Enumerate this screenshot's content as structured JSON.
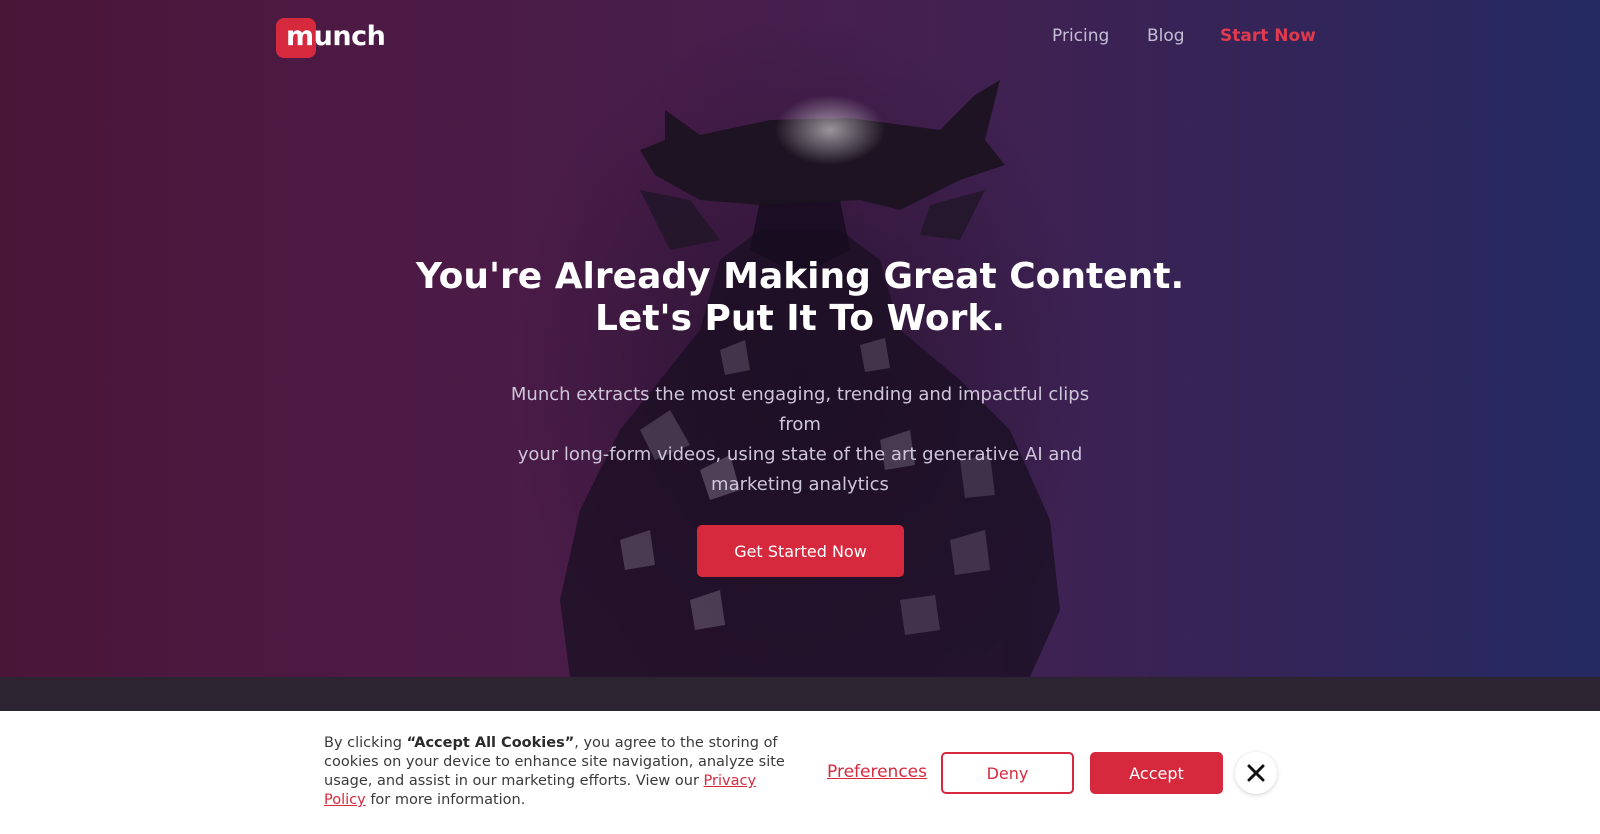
{
  "nav": {
    "logo_text": "munch",
    "links": [
      "Pricing",
      "Blog",
      "Start Now"
    ]
  },
  "hero": {
    "headline_line1": "You're Already Making Great Content.",
    "headline_line2": "Let's Put It To Work.",
    "subtext_line1": "Munch extracts the most engaging, trending and impactful clips from",
    "subtext_line2": "your long-form videos, using state of the art generative AI and",
    "subtext_line3": "marketing analytics",
    "cta_label": "Get Started Now"
  },
  "cookie": {
    "text_before": "By clicking ",
    "text_bold": "“Accept All Cookies”",
    "text_middle": ", you agree to the storing of cookies on your device to enhance site navigation, analyze site usage, and assist in our marketing efforts. View our ",
    "privacy_link": "Privacy Policy",
    "text_after": " for more information.",
    "preferences_label": "Preferences",
    "deny_label": "Deny",
    "accept_label": "Accept"
  },
  "icons": {
    "close": "close-icon",
    "hero_figure": "hero-figure-image"
  },
  "colors": {
    "brand_red": "#d6293e",
    "nav_link": "#c6bed6",
    "background_left": "#4a1638",
    "background_right": "#252a63",
    "cookie_bg": "#ffffff"
  }
}
